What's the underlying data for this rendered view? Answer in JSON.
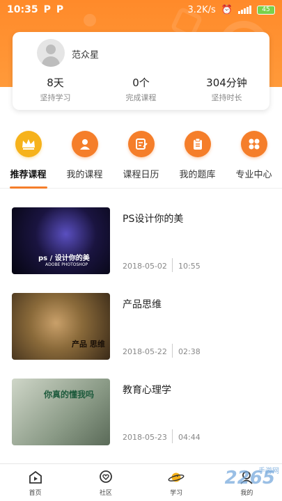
{
  "status_bar": {
    "time": "10:35",
    "p1": "P",
    "p2": "P",
    "speed": "3.2K/s",
    "battery": "45"
  },
  "profile": {
    "name": "范众星",
    "stats": [
      {
        "value": "8天",
        "label": "坚持学习"
      },
      {
        "value": "0个",
        "label": "完成课程"
      },
      {
        "value": "304分钟",
        "label": "坚持时长"
      }
    ]
  },
  "categories": [
    {
      "label": "推荐课程",
      "icon": "crown-icon",
      "active": true
    },
    {
      "label": "我的课程",
      "icon": "user-icon",
      "active": false
    },
    {
      "label": "课程日历",
      "icon": "calendar-edit-icon",
      "active": false
    },
    {
      "label": "我的题库",
      "icon": "clipboard-icon",
      "active": false
    },
    {
      "label": "专业中心",
      "icon": "grid-icon",
      "active": false
    }
  ],
  "courses": [
    {
      "title": "PS设计你的美",
      "date": "2018-05-02",
      "time": "10:55",
      "thumb_text": "ps / 设计你的美",
      "thumb_sub": "ADOBE PHOTOSHOP"
    },
    {
      "title": "产品思维",
      "date": "2018-05-22",
      "time": "02:38",
      "thumb_text": "产品 思维"
    },
    {
      "title": "教育心理学",
      "date": "2018-05-23",
      "time": "04:44",
      "thumb_text": "你真的懂我吗"
    }
  ],
  "bottom_nav": [
    {
      "label": "首页",
      "icon": "play-home-icon"
    },
    {
      "label": "社区",
      "icon": "heart-chat-icon"
    },
    {
      "label": "学习",
      "icon": "planet-icon"
    },
    {
      "label": "我的",
      "icon": "person-icon"
    }
  ],
  "watermark": {
    "text": "2265",
    "sub": "手游网"
  },
  "colors": {
    "accent": "#f57e2a",
    "gold": "#f6b21b",
    "header": "#ff8a2a"
  }
}
